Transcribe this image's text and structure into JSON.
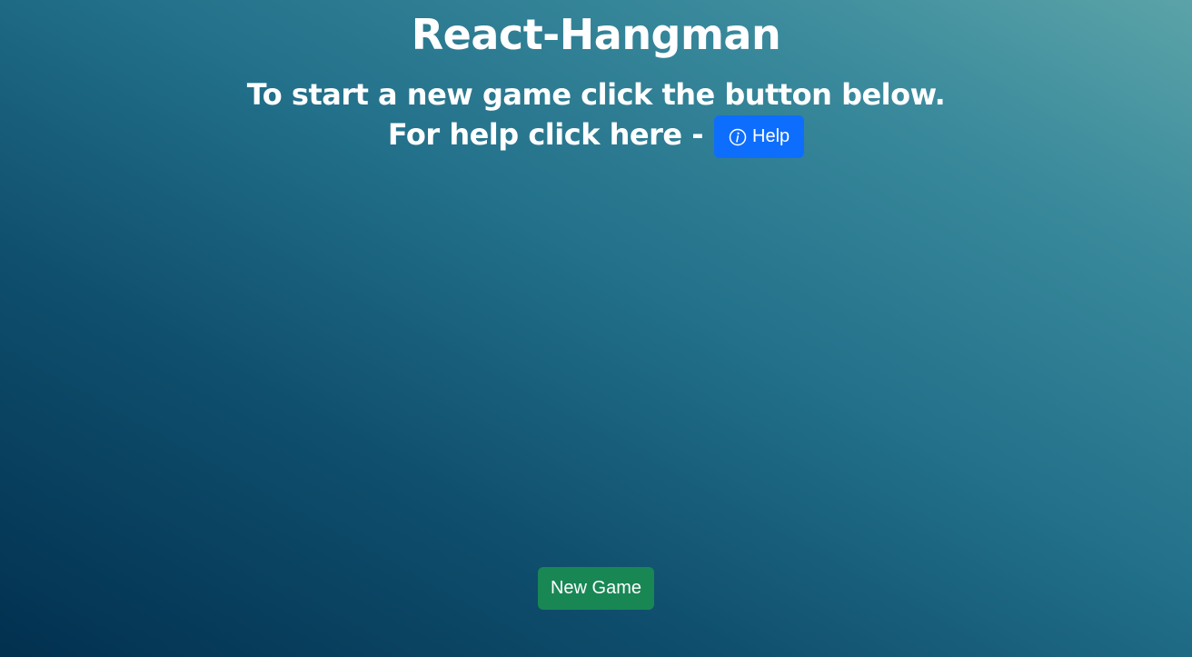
{
  "app": {
    "title": "React-Hangman",
    "instruction": "To start a new game click the button below.",
    "help_prompt": "For help click here -",
    "help_button_label": "Help",
    "new_game_button_label": "New Game"
  },
  "icons": {
    "help": "info-circle-icon"
  },
  "colors": {
    "help_button": "#0d6efd",
    "new_game_button": "#198754",
    "background_dark": "#02304f",
    "background_light": "#5ba3a8"
  }
}
